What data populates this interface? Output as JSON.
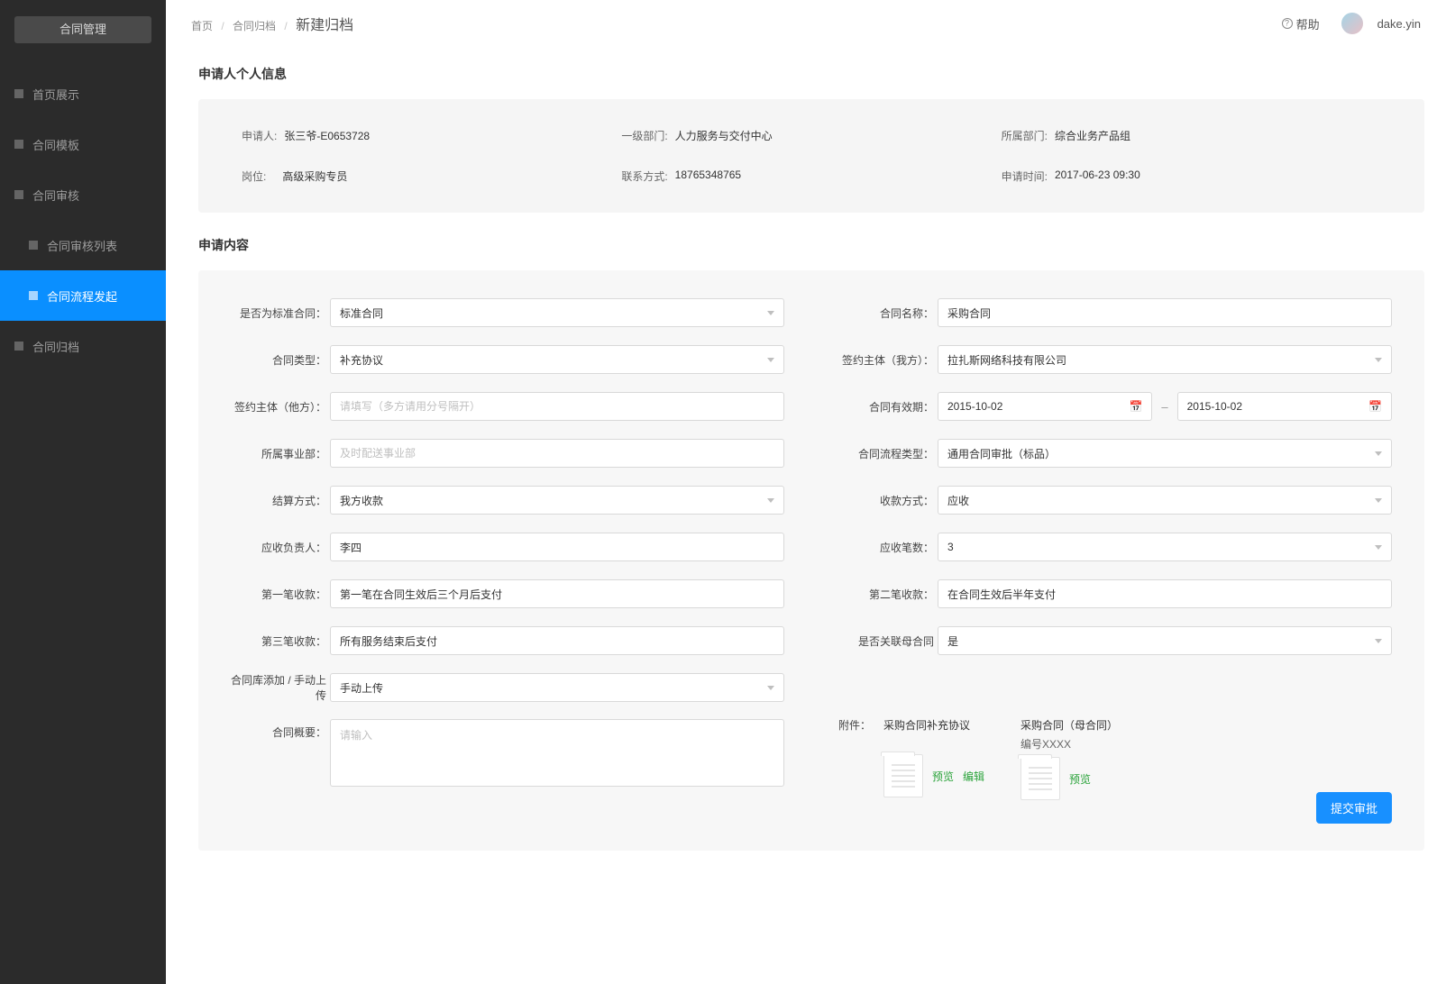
{
  "sidebar": {
    "title": "合同管理",
    "items": [
      {
        "label": "首页展示"
      },
      {
        "label": "合同模板"
      },
      {
        "label": "合同审核"
      },
      {
        "label": "合同审核列表"
      },
      {
        "label": "合同流程发起"
      },
      {
        "label": "合同归档"
      }
    ]
  },
  "breadcrumb": {
    "home": "首页",
    "mid": "合同归档",
    "current": "新建归档"
  },
  "topbar": {
    "help": "帮助",
    "user": "dake.yin"
  },
  "applicant": {
    "section_title": "申请人个人信息",
    "name_label": "申请人:",
    "name": "张三爷-E0653728",
    "dept1_label": "一级部门:",
    "dept1": "人力服务与交付中心",
    "owndept_label": "所属部门:",
    "owndept": "综合业务产品组",
    "post_label": "岗位:",
    "post": "高级采购专员",
    "contact_label": "联系方式:",
    "contact": "18765348765",
    "applytime_label": "申请时间:",
    "applytime": "2017-06-23 09:30"
  },
  "form": {
    "section_title": "申请内容",
    "is_std_label": "是否为标准合同：",
    "is_std": "标准合同",
    "name_label": "合同名称：",
    "name_value": "采购合同",
    "type_label": "合同类型：",
    "type": "补充协议",
    "our_label": "签约主体（我方）：",
    "our": "拉扎斯网络科技有限公司",
    "their_label": "签约主体（他方）：",
    "their_placeholder": "请填写（多方请用分号隔开）",
    "period_label": "合同有效期：",
    "date_from": "2015-10-02",
    "date_to": "2015-10-02",
    "bu_label": "所属事业部：",
    "bu_placeholder": "及时配送事业部",
    "flow_label": "合同流程类型：",
    "flow": "通用合同审批（标品）",
    "settle_label": "结算方式：",
    "settle": "我方收款",
    "recv_label": "收款方式：",
    "recv": "应收",
    "owner_label": "应收负责人：",
    "owner": "李四",
    "count_label": "应收笔数：",
    "count": "3",
    "pay1_label": "第一笔收款：",
    "pay1": "第一笔在合同生效后三个月后支付",
    "pay2_label": "第二笔收款：",
    "pay2": "在合同生效后半年支付",
    "pay3_label": "第三笔收款：",
    "pay3": "所有服务结束后支付",
    "link_label": "是否关联母合同",
    "link": "是",
    "upload_label": "合同库添加 / 手动上传",
    "upload": "手动上传",
    "summary_label": "合同概要：",
    "summary_placeholder": "请输入",
    "attach_label": "附件：",
    "attach1_title": "采购合同补充协议",
    "attach2_title": "采购合同（母合同）",
    "attach2_sub": "编号XXXX",
    "preview": "预览",
    "edit": "编辑",
    "submit": "提交审批"
  }
}
